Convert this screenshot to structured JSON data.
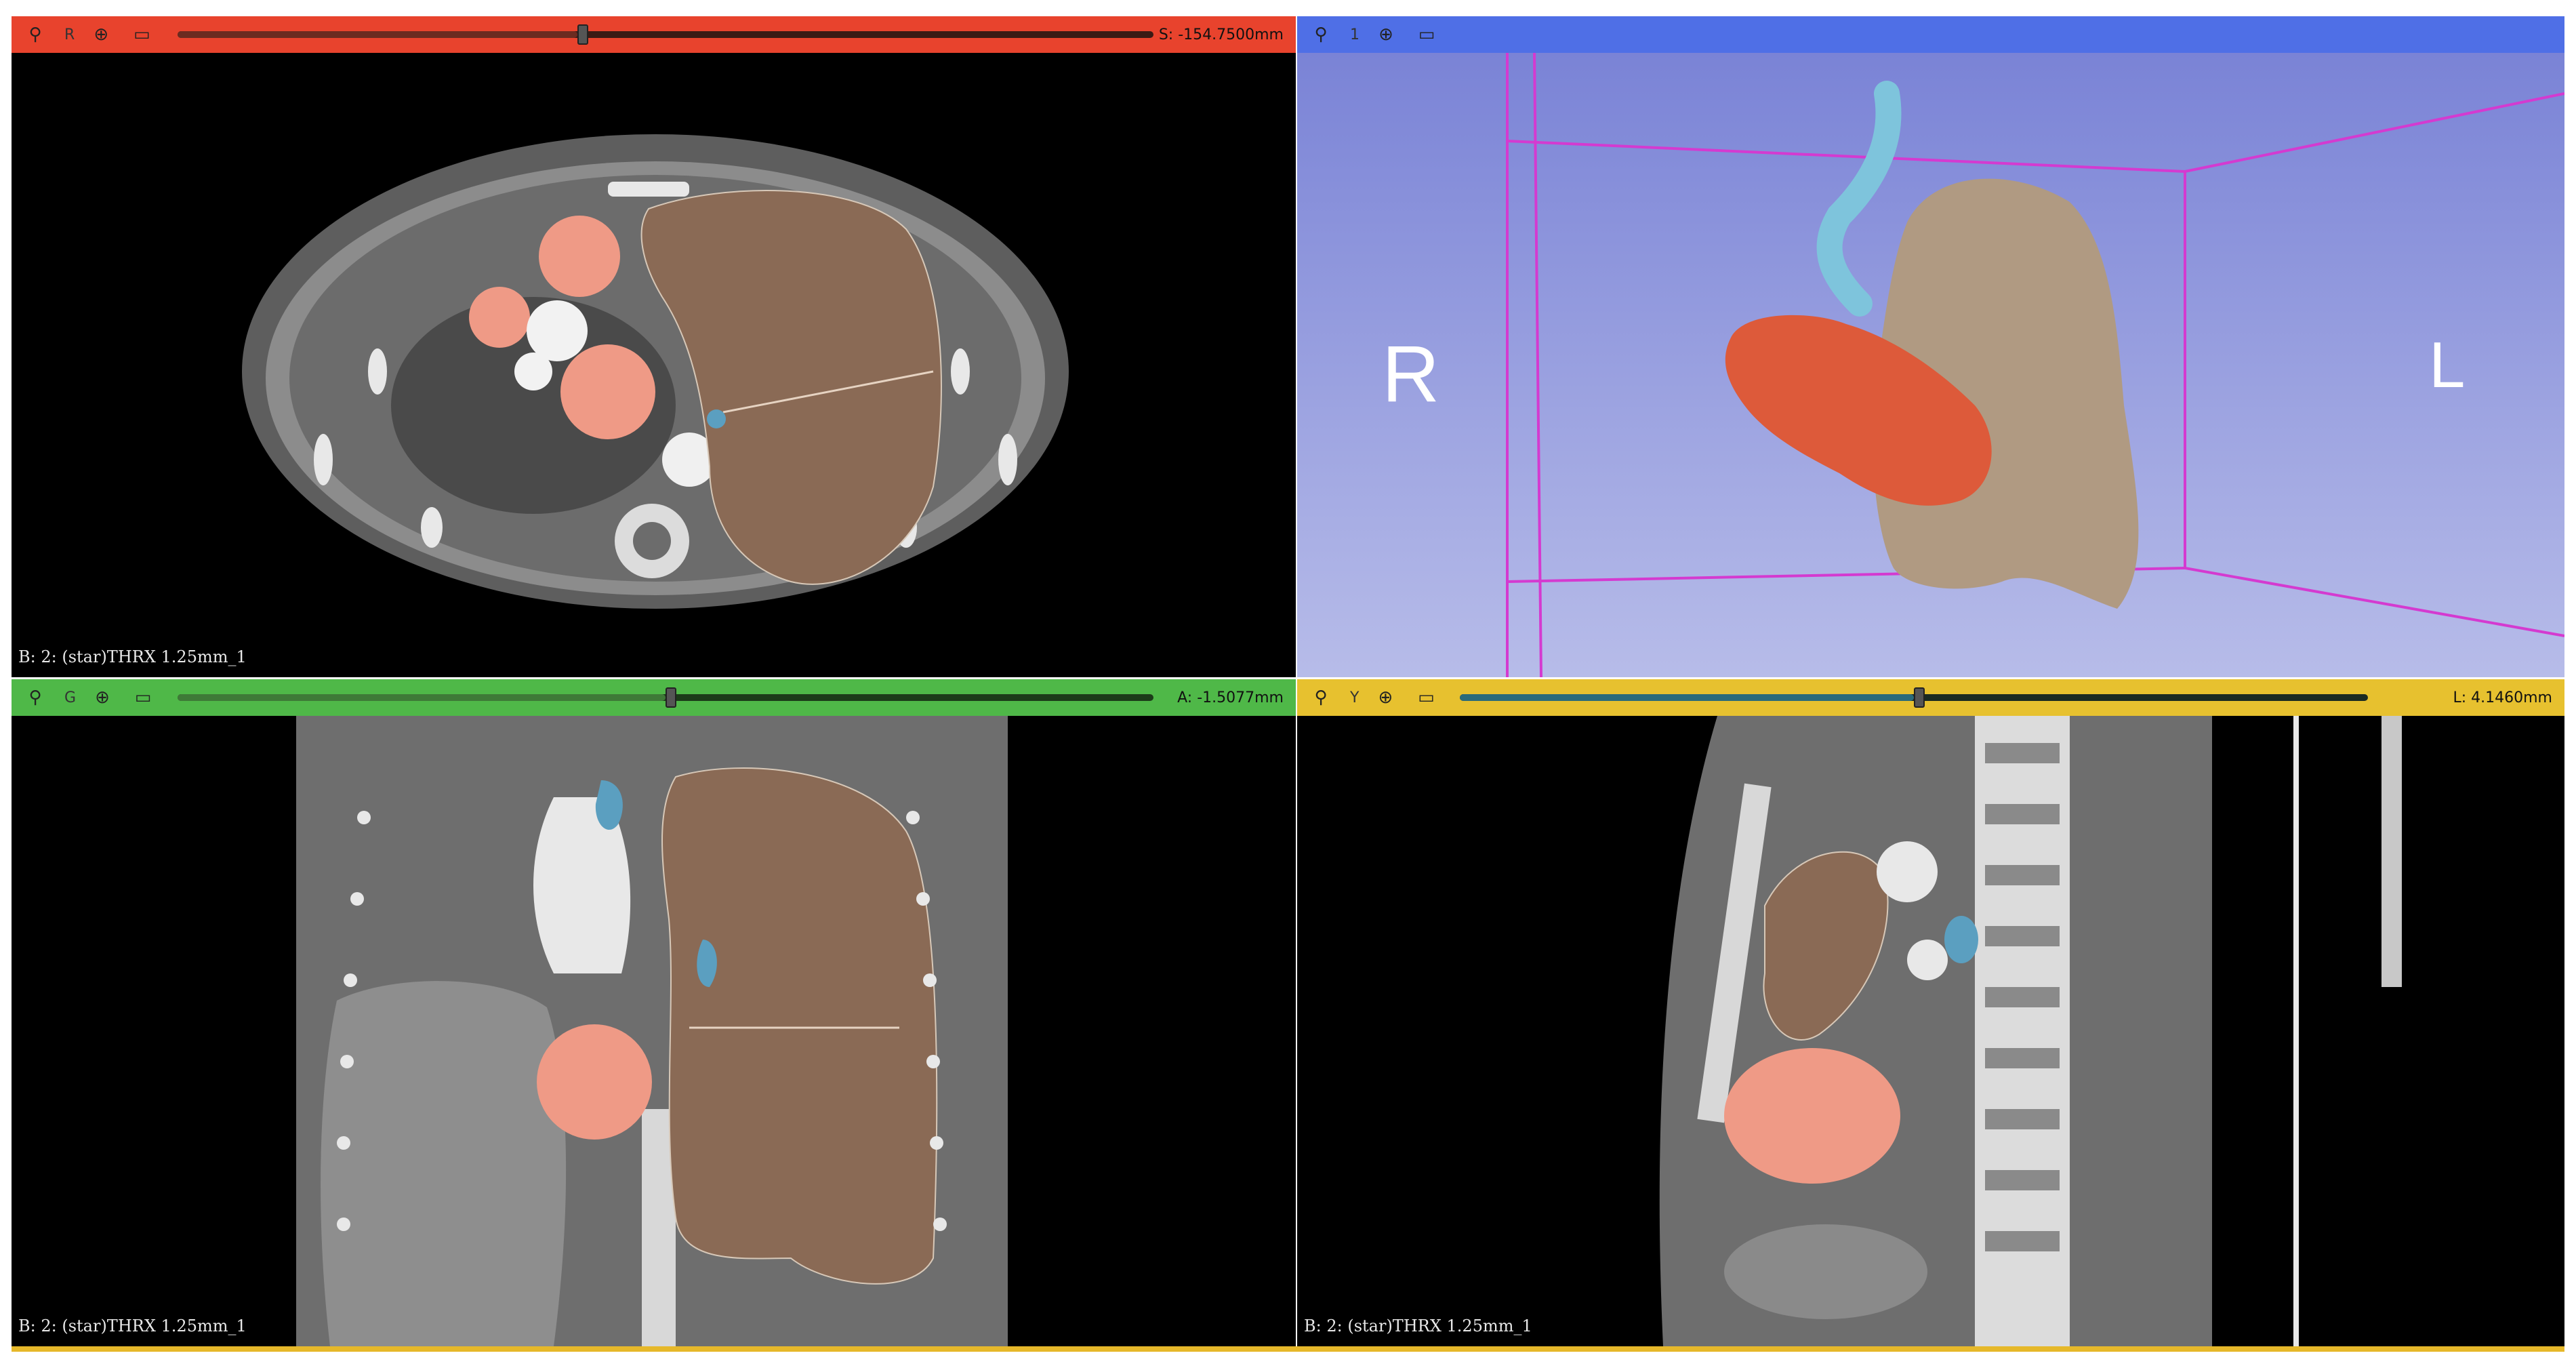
{
  "views": {
    "red": {
      "letter": "R",
      "offset": "S: -154.7500mm",
      "volume_label": "B: 2: (star)THRX 1.25mm_1",
      "slider_position": 0.41,
      "bar_color": "#e8432d"
    },
    "threed": {
      "letter": "1",
      "left_orientation": "R",
      "right_orientation": "L",
      "bar_color": "#4f6fe6",
      "background_top": "#7a83d6",
      "background_bottom": "#b7bce9"
    },
    "green": {
      "letter": "G",
      "offset": "A: -1.5077mm",
      "volume_label": "B: 2: (star)THRX 1.25mm_1",
      "slider_position": 0.5,
      "bar_color": "#4fb848"
    },
    "yellow": {
      "letter": "Y",
      "offset": "L: 4.1460mm",
      "volume_label": "B: 2: (star)THRX 1.25mm_1",
      "slider_position": 0.5,
      "bar_color": "#e7c12f"
    }
  },
  "icons": {
    "pin": "pin-icon",
    "link": "link-icon",
    "maximize": "maximize-view-icon"
  },
  "segment_colors": {
    "left_lung": "#8a6a55",
    "heart": "#ef9a86",
    "airway": "#5b9fc0",
    "lung_3d": "#b09a82",
    "heart_3d": "#dd5a3a",
    "trachea_3d": "#7ec4dc"
  }
}
